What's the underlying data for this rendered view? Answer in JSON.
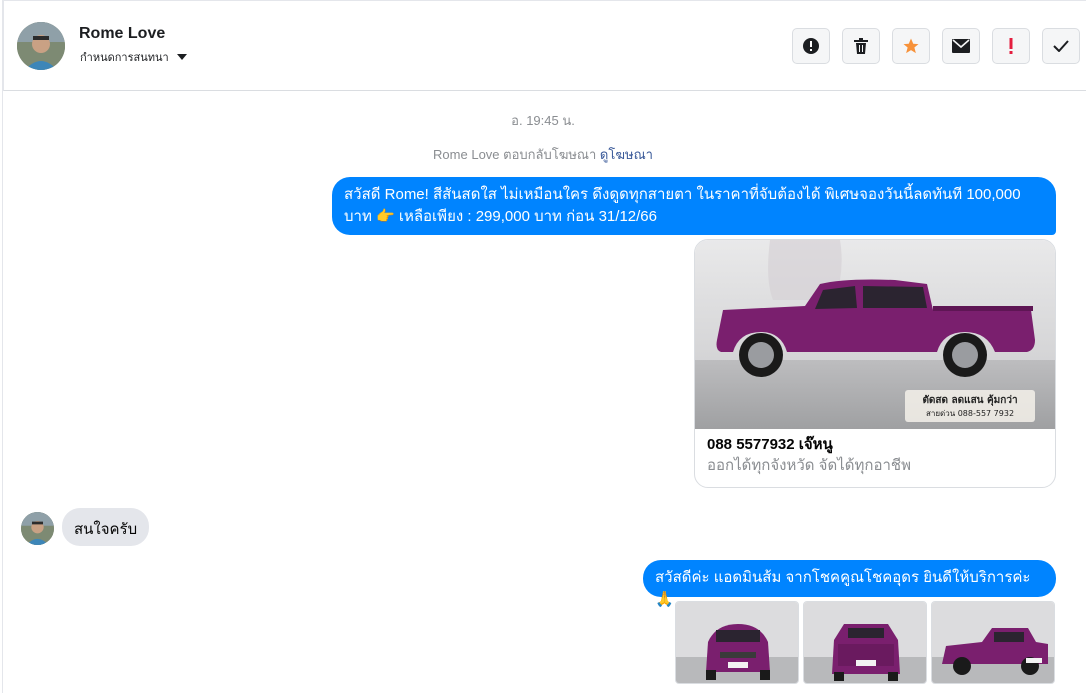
{
  "header": {
    "contact_name": "Rome Love",
    "settings_label": "กำหนดการสนทนา",
    "toolbar": [
      {
        "name": "report-button",
        "icon": "alert-circle-icon"
      },
      {
        "name": "delete-button",
        "icon": "trash-icon"
      },
      {
        "name": "star-button",
        "icon": "star-icon"
      },
      {
        "name": "mark-unread-button",
        "icon": "envelope-icon"
      },
      {
        "name": "important-button",
        "icon": "exclamation-icon"
      },
      {
        "name": "mark-done-button",
        "icon": "check-icon"
      }
    ]
  },
  "conversation": {
    "timestamp": "อ. 19:45 น.",
    "reply_note": "Rome Love ตอบกลับโฆษณา",
    "reply_link": "ดูโฆษณา",
    "outgoing_1": "สวัสดี Rome! สีสันสดใส ไม่เหมือนใคร ดึงดูดทุกสายตา ในราคาที่จับต้องได้ พิเศษจองวันนี้ลดทันที 100,000 บาท 👉 เหลือเพียง : 299,000 บาท ก่อน 31/12/66",
    "ad": {
      "title": "088 5577932 เจ๊หนู",
      "subtitle": "ออกได้ทุกจังหวัด จัดได้ทุกอาชีพ",
      "image_caption_1": "ตัดสด ลดแสน คุ้มกว่า",
      "image_caption_2": "สายด่วน 088-557 7932"
    },
    "incoming_1": "สนใจครับ",
    "outgoing_2": "สวัสดีค่ะ แอดมินส้ม จากโชคคูณโชคอุดร ยินดีให้บริการค่ะ🙏"
  },
  "colors": {
    "accent": "#0084ff",
    "car": "#7a1f6e",
    "star": "#f7923a",
    "important": "#e41e3f"
  }
}
